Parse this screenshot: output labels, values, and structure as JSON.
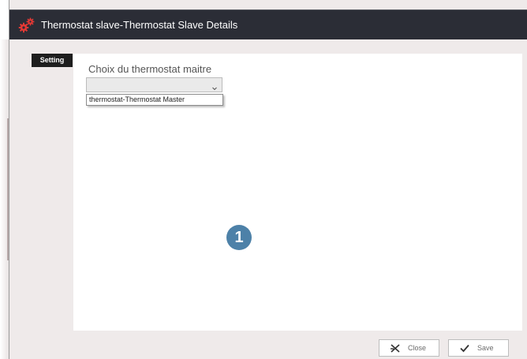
{
  "window": {
    "title": "Thermostat slave-Thermostat Slave Details",
    "icon": "gears-icon"
  },
  "tabs": [
    {
      "label": "Setting",
      "active": true
    }
  ],
  "form": {
    "field_label": "Choix du thermostat maitre",
    "combo_value": "",
    "options": [
      "thermostat-Thermostat Master"
    ]
  },
  "annotation": {
    "step": "1",
    "color": "#4d81a8"
  },
  "buttons": {
    "close_label": "Close",
    "save_label": "Save"
  },
  "colors": {
    "titlebar": "#2b2d36",
    "tab": "#1e1e1e",
    "background": "#efeaea",
    "gear_accent": "#e53935"
  }
}
